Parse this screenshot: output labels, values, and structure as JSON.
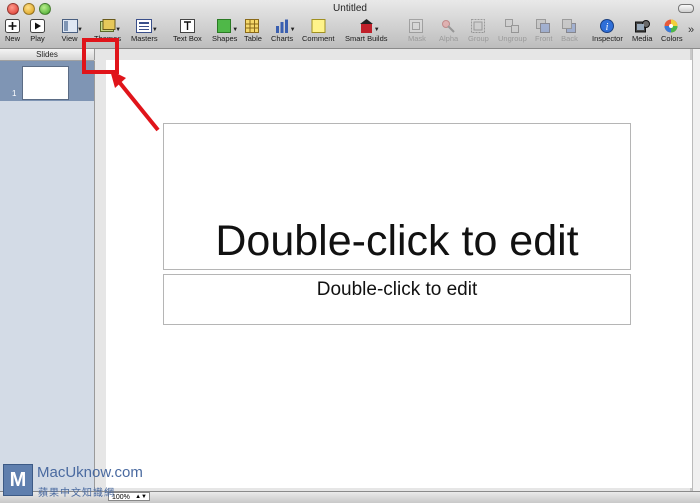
{
  "window": {
    "title": "Untitled"
  },
  "toolbar": {
    "items": [
      {
        "label": "New"
      },
      {
        "label": "Play"
      },
      {
        "label": "View"
      },
      {
        "label": "Themes"
      },
      {
        "label": "Masters"
      },
      {
        "label": "Text Box"
      },
      {
        "label": "Shapes"
      },
      {
        "label": "Table"
      },
      {
        "label": "Charts"
      },
      {
        "label": "Comment"
      },
      {
        "label": "Smart Builds"
      },
      {
        "label": "Mask"
      },
      {
        "label": "Alpha"
      },
      {
        "label": "Group"
      },
      {
        "label": "Ungroup"
      },
      {
        "label": "Front"
      },
      {
        "label": "Back"
      },
      {
        "label": "Inspector"
      },
      {
        "label": "Media"
      },
      {
        "label": "Colors"
      }
    ],
    "overflow": "»"
  },
  "slides_panel": {
    "header": "Slides",
    "slides": [
      {
        "number": "1"
      }
    ]
  },
  "slide": {
    "title_placeholder": "Double-click to edit",
    "subtitle_placeholder": "Double-click to edit"
  },
  "status": {
    "zoom": "100%"
  },
  "watermark": {
    "site": "MacUknow.com",
    "chinese": "蘋果中文知識網",
    "logo_letter": "M"
  },
  "colors": {
    "annotation": "#e0141a",
    "selected_slide": "#7f95b4"
  }
}
